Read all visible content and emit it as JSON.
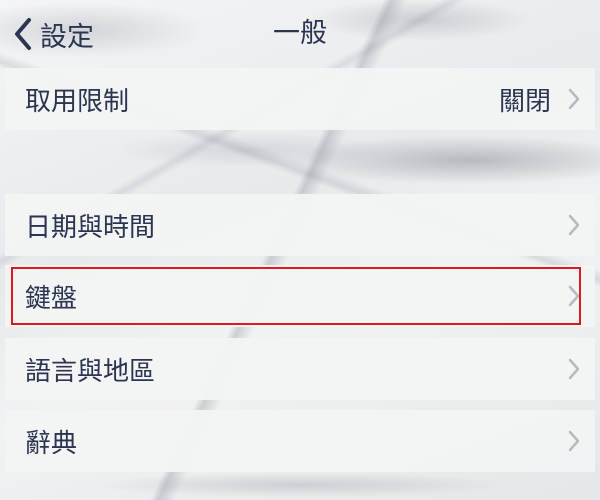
{
  "nav": {
    "back_label": "設定",
    "title": "一般"
  },
  "groups": [
    {
      "items": [
        {
          "label": "取用限制",
          "value": "關閉"
        }
      ]
    },
    {
      "items": [
        {
          "label": "日期與時間"
        },
        {
          "label": "鍵盤",
          "highlighted": true
        },
        {
          "label": "語言與地區"
        },
        {
          "label": "辭典"
        }
      ]
    }
  ],
  "colors": {
    "text": "#2b3450",
    "cell_background": "#f2f4f4",
    "highlight_border": "#e0191f",
    "chevron": "#b6b9c0"
  },
  "icons": {
    "back": "chevron-left-icon",
    "disclosure": "chevron-right-icon"
  }
}
